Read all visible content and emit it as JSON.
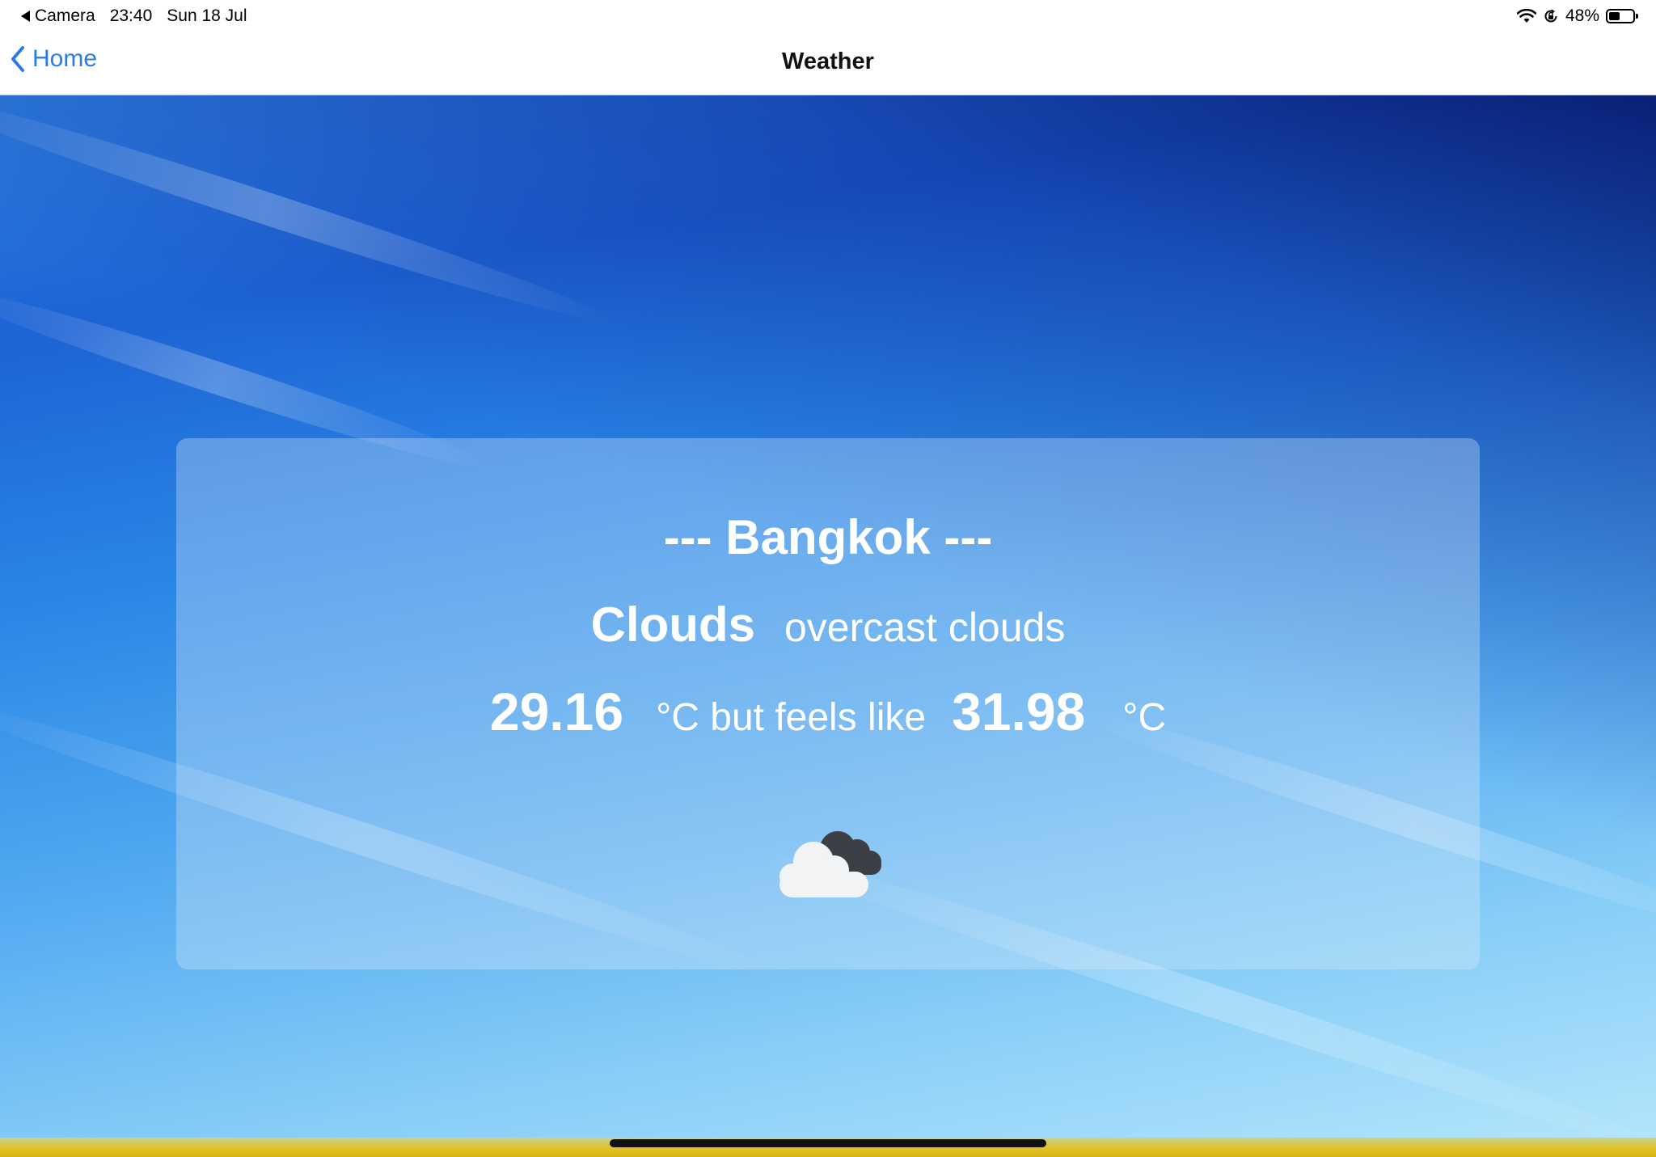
{
  "status_bar": {
    "back_app": "Camera",
    "time": "23:40",
    "date": "Sun 18 Jul",
    "battery_percent": "48%",
    "battery_level": 0.48
  },
  "nav": {
    "back_label": "Home",
    "title": "Weather"
  },
  "weather": {
    "city": "--- Bangkok ---",
    "condition": "Clouds",
    "description": "overcast clouds",
    "temperature": "29.16",
    "temp_text": "°C but feels like",
    "feels_like": "31.98",
    "unit": "°C",
    "icon": "overcast-clouds-icon"
  },
  "colors": {
    "accent": "#2b7be5"
  }
}
